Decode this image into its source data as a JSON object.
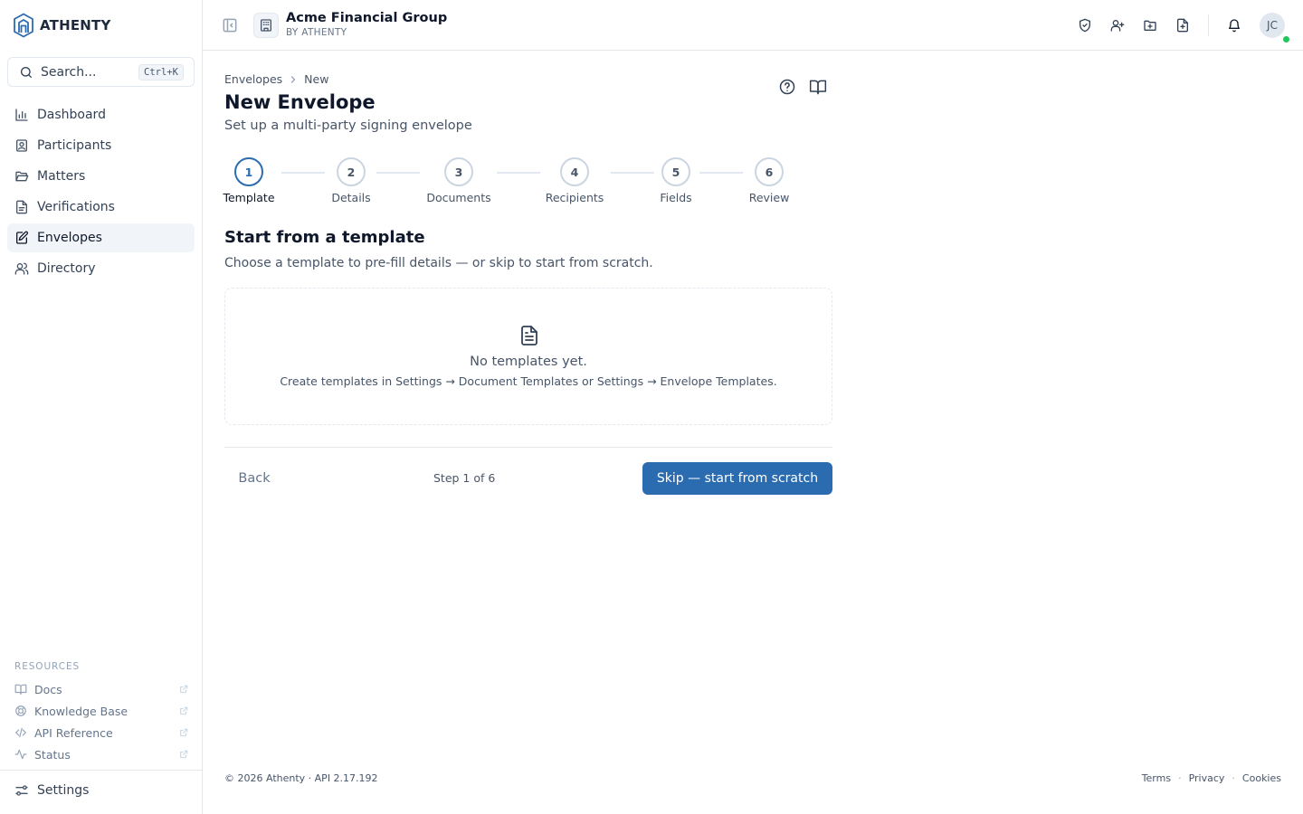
{
  "brand": {
    "name": "ATHENTY",
    "accent": "#2b6cb0"
  },
  "search": {
    "placeholder": "Search...",
    "shortcut": "Ctrl+K"
  },
  "sidebar": {
    "items": [
      {
        "label": "Dashboard",
        "icon": "bar-chart-icon",
        "active": false
      },
      {
        "label": "Participants",
        "icon": "contact-card-icon",
        "active": false
      },
      {
        "label": "Matters",
        "icon": "folder-open-icon",
        "active": false
      },
      {
        "label": "Verifications",
        "icon": "document-check-icon",
        "active": false
      },
      {
        "label": "Envelopes",
        "icon": "document-edit-icon",
        "active": true
      },
      {
        "label": "Directory",
        "icon": "users-icon",
        "active": false
      }
    ],
    "resources_label": "RESOURCES",
    "resources": [
      {
        "label": "Docs",
        "icon": "book-icon"
      },
      {
        "label": "Knowledge Base",
        "icon": "lifebuoy-icon"
      },
      {
        "label": "API Reference",
        "icon": "code-icon"
      },
      {
        "label": "Status",
        "icon": "activity-icon"
      }
    ],
    "settings_label": "Settings"
  },
  "header": {
    "org_name": "Acme Financial Group",
    "org_sub": "BY ATHENTY",
    "avatar_initials": "JC"
  },
  "breadcrumb": {
    "parent": "Envelopes",
    "current": "New"
  },
  "page": {
    "title": "New Envelope",
    "subtitle": "Set up a multi-party signing envelope"
  },
  "steps": [
    {
      "number": "1",
      "label": "Template",
      "active": true
    },
    {
      "number": "2",
      "label": "Details",
      "active": false
    },
    {
      "number": "3",
      "label": "Documents",
      "active": false
    },
    {
      "number": "4",
      "label": "Recipients",
      "active": false
    },
    {
      "number": "5",
      "label": "Fields",
      "active": false
    },
    {
      "number": "6",
      "label": "Review",
      "active": false
    }
  ],
  "template_section": {
    "title": "Start from a template",
    "description": "Choose a template to pre-fill details — or skip to start from scratch.",
    "empty_title": "No templates yet.",
    "empty_description": "Create templates in Settings → Document Templates or Settings → Envelope Templates."
  },
  "wizard_footer": {
    "back_label": "Back",
    "step_count": "Step 1 of 6",
    "skip_label": "Skip — start from scratch"
  },
  "footer": {
    "copyright": "© 2026 Athenty · API 2.17.192",
    "links": [
      "Terms",
      "Privacy",
      "Cookies"
    ]
  }
}
